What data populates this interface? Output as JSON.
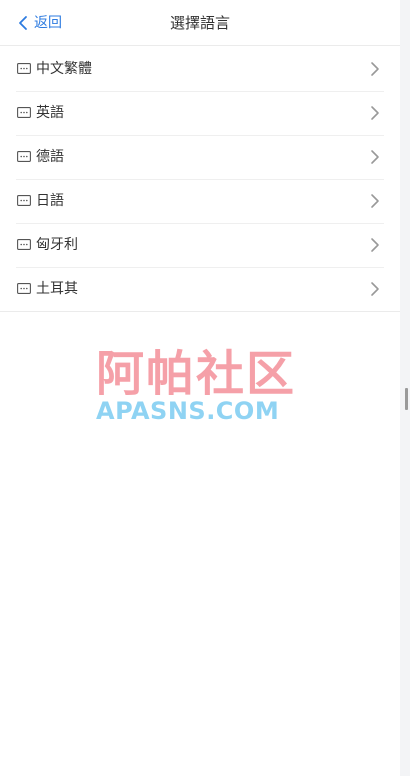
{
  "header": {
    "back_label": "返回",
    "title": "選擇語言"
  },
  "languages": [
    {
      "label": "中文繁體"
    },
    {
      "label": "英語"
    },
    {
      "label": "德語"
    },
    {
      "label": "日語"
    },
    {
      "label": "匈牙利"
    },
    {
      "label": "土耳其"
    }
  ],
  "watermark": {
    "chinese": "阿帕社区",
    "english": "APASNS.COM"
  },
  "colors": {
    "accent": "#2d7be0",
    "text": "#333333",
    "chevron": "#999999",
    "watermark_cn": "#f5a0a8",
    "watermark_en": "#8fd3f3"
  },
  "icons": {
    "back": "chevron-left-icon",
    "row": "message-dots-icon",
    "row_action": "chevron-right-icon"
  }
}
